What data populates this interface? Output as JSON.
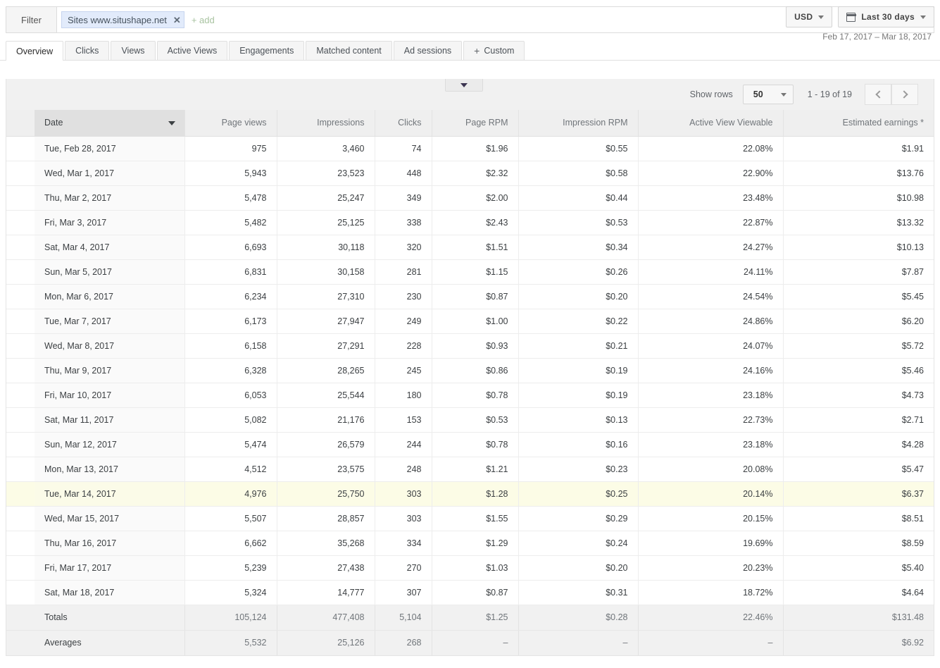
{
  "filter": {
    "label": "Filter",
    "chip": {
      "text": "Sites www.situshape.net",
      "remove_icon": "close-icon"
    },
    "add_placeholder": "+ add",
    "clear_icon": "close-icon"
  },
  "toolbar_right": {
    "currency": "USD",
    "date_range_button": "Last 30 days",
    "calendar_icon": "calendar-icon",
    "date_range_text": "Feb 17, 2017 – Mar 18, 2017"
  },
  "tabs": [
    {
      "label": "Overview",
      "active": true
    },
    {
      "label": "Clicks",
      "active": false
    },
    {
      "label": "Views",
      "active": false
    },
    {
      "label": "Active Views",
      "active": false
    },
    {
      "label": "Engagements",
      "active": false
    },
    {
      "label": "Matched content",
      "active": false
    },
    {
      "label": "Ad sessions",
      "active": false
    },
    {
      "label": "Custom",
      "active": false,
      "plus": "+"
    }
  ],
  "collapse_handle": {
    "icon": "chevron-down-icon"
  },
  "table_toolbar": {
    "show_rows_label": "Show rows",
    "rows_value": "50",
    "range_text": "1 - 19 of 19",
    "prev_icon": "chevron-left-icon",
    "next_icon": "chevron-right-icon"
  },
  "table": {
    "columns": [
      "Date",
      "Page views",
      "Impressions",
      "Clicks",
      "Page RPM",
      "Impression RPM",
      "Active View Viewable",
      "Estimated earnings *"
    ],
    "sorted_column": "Date",
    "highlighted_row_index": 14,
    "rows": [
      [
        "Tue, Feb 28, 2017",
        "975",
        "3,460",
        "74",
        "$1.96",
        "$0.55",
        "22.08%",
        "$1.91"
      ],
      [
        "Wed, Mar 1, 2017",
        "5,943",
        "23,523",
        "448",
        "$2.32",
        "$0.58",
        "22.90%",
        "$13.76"
      ],
      [
        "Thu, Mar 2, 2017",
        "5,478",
        "25,247",
        "349",
        "$2.00",
        "$0.44",
        "23.48%",
        "$10.98"
      ],
      [
        "Fri, Mar 3, 2017",
        "5,482",
        "25,125",
        "338",
        "$2.43",
        "$0.53",
        "22.87%",
        "$13.32"
      ],
      [
        "Sat, Mar 4, 2017",
        "6,693",
        "30,118",
        "320",
        "$1.51",
        "$0.34",
        "24.27%",
        "$10.13"
      ],
      [
        "Sun, Mar 5, 2017",
        "6,831",
        "30,158",
        "281",
        "$1.15",
        "$0.26",
        "24.11%",
        "$7.87"
      ],
      [
        "Mon, Mar 6, 2017",
        "6,234",
        "27,310",
        "230",
        "$0.87",
        "$0.20",
        "24.54%",
        "$5.45"
      ],
      [
        "Tue, Mar 7, 2017",
        "6,173",
        "27,947",
        "249",
        "$1.00",
        "$0.22",
        "24.86%",
        "$6.20"
      ],
      [
        "Wed, Mar 8, 2017",
        "6,158",
        "27,291",
        "228",
        "$0.93",
        "$0.21",
        "24.07%",
        "$5.72"
      ],
      [
        "Thu, Mar 9, 2017",
        "6,328",
        "28,265",
        "245",
        "$0.86",
        "$0.19",
        "24.16%",
        "$5.46"
      ],
      [
        "Fri, Mar 10, 2017",
        "6,053",
        "25,544",
        "180",
        "$0.78",
        "$0.19",
        "23.18%",
        "$4.73"
      ],
      [
        "Sat, Mar 11, 2017",
        "5,082",
        "21,176",
        "153",
        "$0.53",
        "$0.13",
        "22.73%",
        "$2.71"
      ],
      [
        "Sun, Mar 12, 2017",
        "5,474",
        "26,579",
        "244",
        "$0.78",
        "$0.16",
        "23.18%",
        "$4.28"
      ],
      [
        "Mon, Mar 13, 2017",
        "4,512",
        "23,575",
        "248",
        "$1.21",
        "$0.23",
        "20.08%",
        "$5.47"
      ],
      [
        "Tue, Mar 14, 2017",
        "4,976",
        "25,750",
        "303",
        "$1.28",
        "$0.25",
        "20.14%",
        "$6.37"
      ],
      [
        "Wed, Mar 15, 2017",
        "5,507",
        "28,857",
        "303",
        "$1.55",
        "$0.29",
        "20.15%",
        "$8.51"
      ],
      [
        "Thu, Mar 16, 2017",
        "6,662",
        "35,268",
        "334",
        "$1.29",
        "$0.24",
        "19.69%",
        "$8.59"
      ],
      [
        "Fri, Mar 17, 2017",
        "5,239",
        "27,438",
        "270",
        "$1.03",
        "$0.20",
        "20.23%",
        "$5.40"
      ],
      [
        "Sat, Mar 18, 2017",
        "5,324",
        "14,777",
        "307",
        "$0.87",
        "$0.31",
        "18.72%",
        "$4.64"
      ]
    ],
    "summary": [
      [
        "Totals",
        "105,124",
        "477,408",
        "5,104",
        "$1.25",
        "$0.28",
        "22.46%",
        "$131.48"
      ],
      [
        "Averages",
        "5,532",
        "25,126",
        "268",
        "–",
        "–",
        "–",
        "$6.92"
      ]
    ]
  }
}
